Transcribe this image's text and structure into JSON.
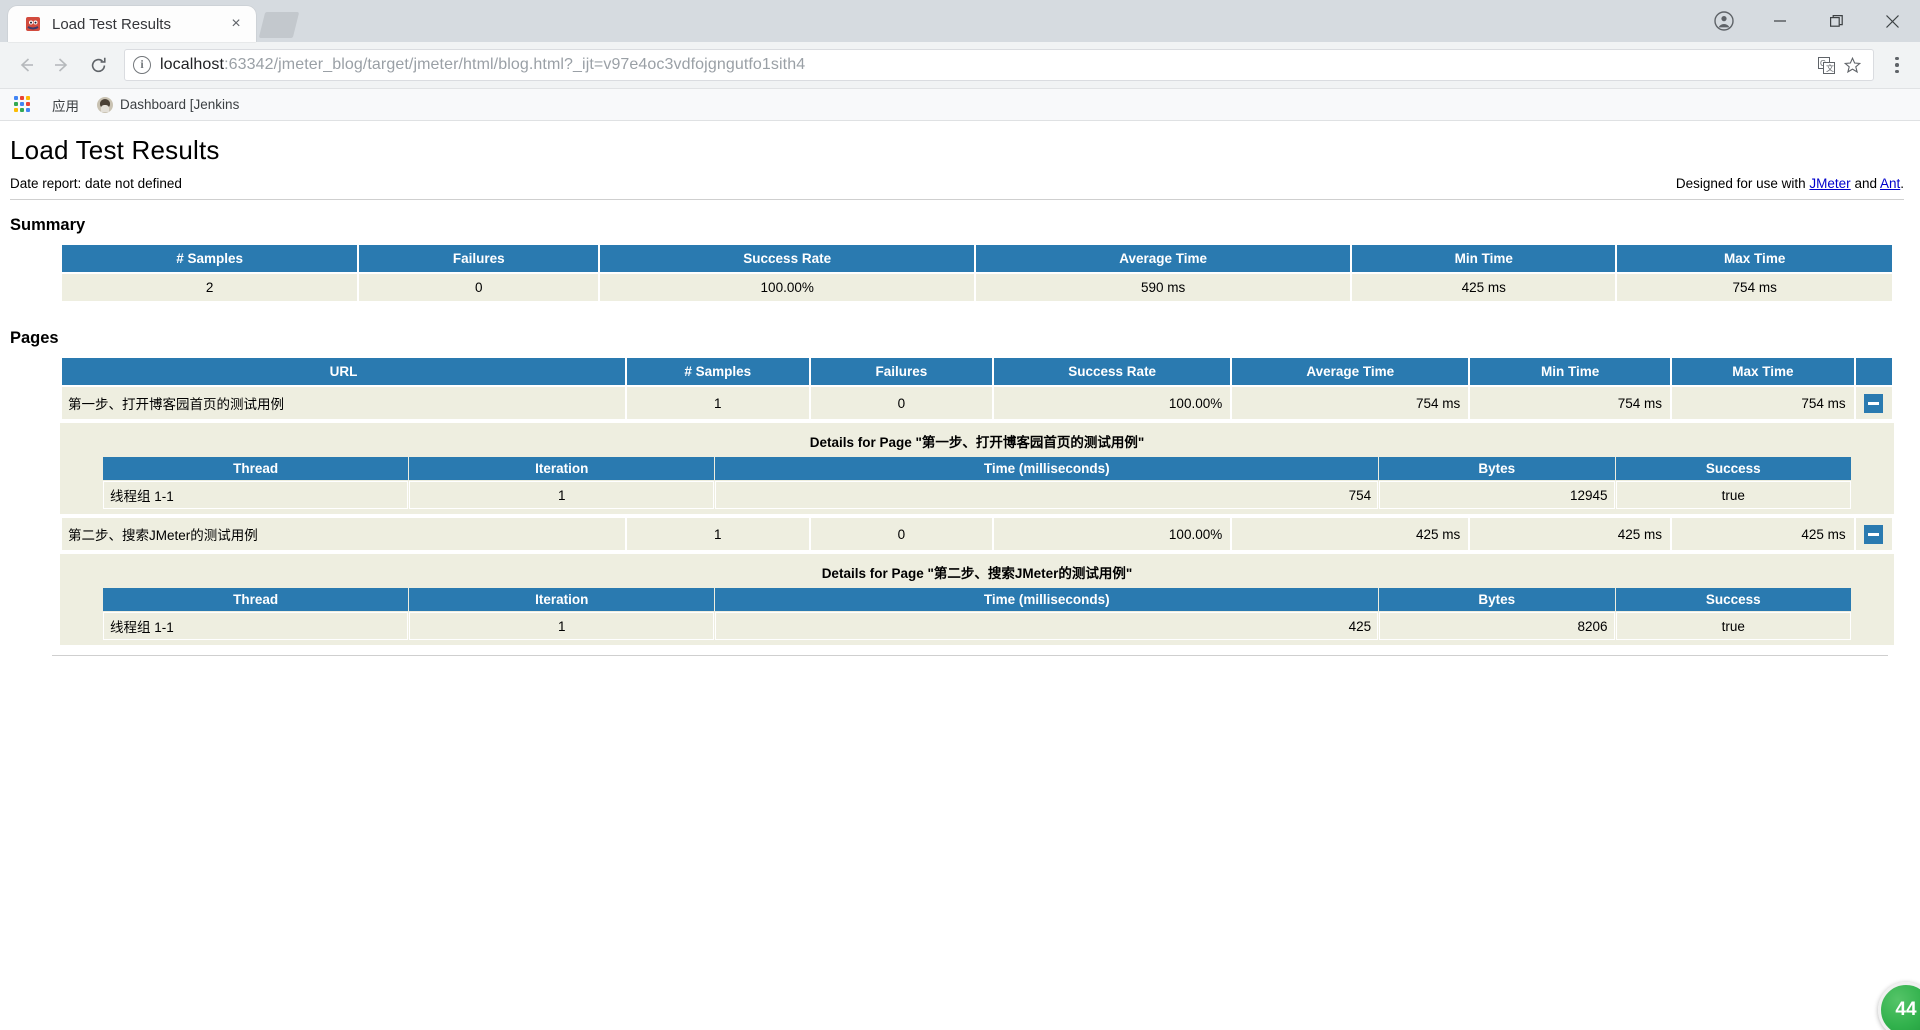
{
  "browser": {
    "tab": {
      "title": "Load Test Results",
      "favicon": "jmeter-favicon",
      "close": "×"
    },
    "new_tab_label": "+",
    "window_controls": {
      "profile": "profile-avatar",
      "minimize": "–",
      "maximize": "▭",
      "close": "✕"
    },
    "nav": {
      "back": "←",
      "forward": "→",
      "reload": "⟳"
    },
    "omnibox": {
      "info": "i",
      "url_host": "localhost",
      "url_path": ":63342/jmeter_blog/target/jmeter/html/blog.html?_ijt=v97e4oc3vdfojgngutfo1sith4",
      "translate_icon": "translate-icon",
      "star_icon": "☆"
    },
    "bookmarks": {
      "apps_label": "应用",
      "items": [
        {
          "label": "Dashboard [Jenkins"
        }
      ]
    }
  },
  "report": {
    "title": "Load Test Results",
    "date_report": "Date report: date not defined",
    "credit_prefix": "Designed for use with ",
    "credit_link1": "JMeter",
    "credit_mid": " and ",
    "credit_link2": "Ant",
    "credit_suffix": "."
  },
  "summary": {
    "heading": "Summary",
    "columns": [
      "# Samples",
      "Failures",
      "Success Rate",
      "Average Time",
      "Min Time",
      "Max Time"
    ],
    "row": [
      "2",
      "0",
      "100.00%",
      "590 ms",
      "425 ms",
      "754 ms"
    ]
  },
  "pages": {
    "heading": "Pages",
    "columns": [
      "URL",
      "# Samples",
      "Failures",
      "Success Rate",
      "Average Time",
      "Min Time",
      "Max Time",
      ""
    ],
    "toggle_label": "−",
    "rows": [
      {
        "url": "第一步、打开博客园首页的测试用例",
        "samples": "1",
        "failures": "0",
        "success_rate": "100.00%",
        "average_time": "754 ms",
        "min_time": "754 ms",
        "max_time": "754 ms",
        "detail": {
          "title": "Details for Page \"第一步、打开博客园首页的测试用例\"",
          "columns": [
            "Thread",
            "Iteration",
            "Time (milliseconds)",
            "Bytes",
            "Success"
          ],
          "rows": [
            {
              "thread": "线程组 1-1",
              "iteration": "1",
              "time": "754",
              "bytes": "12945",
              "success": "true"
            }
          ]
        }
      },
      {
        "url": "第二步、搜索JMeter的测试用例",
        "samples": "1",
        "failures": "0",
        "success_rate": "100.00%",
        "average_time": "425 ms",
        "min_time": "425 ms",
        "max_time": "425 ms",
        "detail": {
          "title": "Details for Page \"第二步、搜索JMeter的测试用例\"",
          "columns": [
            "Thread",
            "Iteration",
            "Time (milliseconds)",
            "Bytes",
            "Success"
          ],
          "rows": [
            {
              "thread": "线程组 1-1",
              "iteration": "1",
              "time": "425",
              "bytes": "8206",
              "success": "true"
            }
          ]
        }
      }
    ]
  },
  "floating_badge": {
    "count": "44"
  },
  "colors": {
    "table_header": "#2a7ab0",
    "table_row": "#eeeee0",
    "link": "#0000cc",
    "badge": "#31b14c"
  }
}
